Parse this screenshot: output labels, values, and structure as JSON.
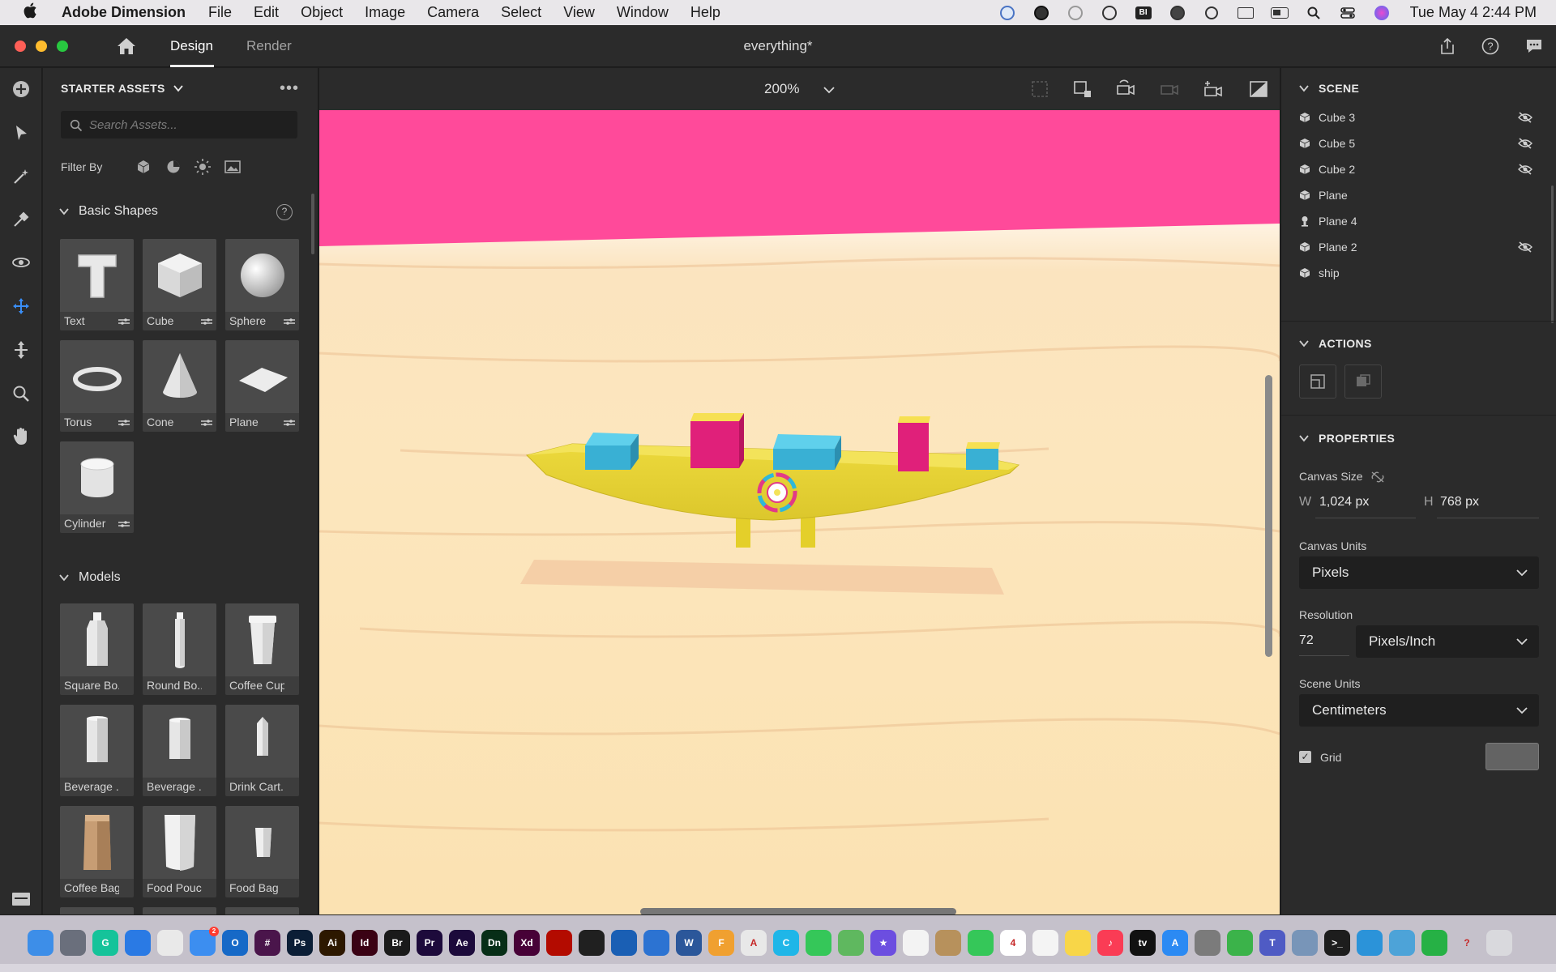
{
  "menubar": {
    "app_name": "Adobe Dimension",
    "items": [
      "File",
      "Edit",
      "Object",
      "Image",
      "Camera",
      "Select",
      "View",
      "Window",
      "Help"
    ],
    "clock": "Tue May 4  2:44 PM"
  },
  "titlebar": {
    "tab_design": "Design",
    "tab_render": "Render",
    "document_title": "everything*"
  },
  "assets": {
    "header": "STARTER ASSETS",
    "search_placeholder": "Search Assets...",
    "filter_label": "Filter By",
    "basic_shapes_title": "Basic Shapes",
    "basic_shapes": [
      {
        "label": "Text",
        "icon": "text-shape-icon"
      },
      {
        "label": "Cube",
        "icon": "cube-shape-icon"
      },
      {
        "label": "Sphere",
        "icon": "sphere-shape-icon"
      },
      {
        "label": "Torus",
        "icon": "torus-shape-icon"
      },
      {
        "label": "Cone",
        "icon": "cone-shape-icon"
      },
      {
        "label": "Plane",
        "icon": "plane-shape-icon"
      },
      {
        "label": "Cylinder",
        "icon": "cylinder-shape-icon"
      }
    ],
    "models_title": "Models",
    "models": [
      {
        "label": "Square Bo...",
        "icon": "square-bottle-icon"
      },
      {
        "label": "Round Bo...",
        "icon": "round-bottle-icon"
      },
      {
        "label": "Coffee Cup",
        "icon": "coffee-cup-icon"
      },
      {
        "label": "Beverage ...",
        "icon": "beverage-can-icon"
      },
      {
        "label": "Beverage ...",
        "icon": "beverage-can-icon"
      },
      {
        "label": "Drink Cart...",
        "icon": "drink-carton-icon"
      },
      {
        "label": "Coffee Bag",
        "icon": "coffee-bag-icon"
      },
      {
        "label": "Food Pouch",
        "icon": "food-pouch-icon"
      },
      {
        "label": "Food Bag",
        "icon": "food-bag-icon"
      }
    ]
  },
  "viewport": {
    "zoom": "200%",
    "colors": {
      "background_wall": "#ff4a9a",
      "floor": "#f7e3bd",
      "ship_hull": "#e8d83a",
      "cube_cyan": "#3ab4d6",
      "cube_magenta": "#e0207a"
    }
  },
  "scene": {
    "title": "SCENE",
    "items": [
      {
        "name": "Cube 3",
        "hidden": true
      },
      {
        "name": "Cube 5",
        "hidden": true
      },
      {
        "name": "Cube 2",
        "hidden": true
      },
      {
        "name": "Plane",
        "hidden": false
      },
      {
        "name": "Plane 4",
        "hidden": false
      },
      {
        "name": "Plane 2",
        "hidden": true
      },
      {
        "name": "ship",
        "hidden": false
      }
    ]
  },
  "actions": {
    "title": "ACTIONS"
  },
  "properties": {
    "title": "PROPERTIES",
    "canvas_size_label": "Canvas Size",
    "width_label": "W",
    "width_value": "1,024 px",
    "height_label": "H",
    "height_value": "768 px",
    "canvas_units_label": "Canvas Units",
    "canvas_units_value": "Pixels",
    "resolution_label": "Resolution",
    "resolution_value": "72",
    "resolution_unit": "Pixels/Inch",
    "scene_units_label": "Scene Units",
    "scene_units_value": "Centimeters",
    "grid_label": "Grid",
    "grid_checked": true
  },
  "dock": {
    "apps": [
      {
        "name": "Finder",
        "color": "#3d8ee8",
        "glyph": ""
      },
      {
        "name": "Launchpad",
        "color": "#6a6f7c",
        "glyph": ""
      },
      {
        "name": "Grammarly",
        "color": "#15c39a",
        "glyph": "G"
      },
      {
        "name": "Safari",
        "color": "#2a7ae4",
        "glyph": ""
      },
      {
        "name": "Chrome",
        "color": "#e9e9e9",
        "glyph": ""
      },
      {
        "name": "Mail",
        "color": "#3c8ef0",
        "glyph": "",
        "badge": "2"
      },
      {
        "name": "Outlook",
        "color": "#1669c7",
        "glyph": "O"
      },
      {
        "name": "Slack",
        "color": "#4a154b",
        "glyph": "#"
      },
      {
        "name": "Photoshop",
        "color": "#0b1e36",
        "glyph": "Ps"
      },
      {
        "name": "Illustrator",
        "color": "#2d1800",
        "glyph": "Ai"
      },
      {
        "name": "InDesign",
        "color": "#3a0214",
        "glyph": "Id"
      },
      {
        "name": "Bridge",
        "color": "#1a1a1a",
        "glyph": "Br"
      },
      {
        "name": "Premiere",
        "color": "#1d0a3b",
        "glyph": "Pr"
      },
      {
        "name": "After Effects",
        "color": "#1c0a3b",
        "glyph": "Ae"
      },
      {
        "name": "Dimension",
        "color": "#072e17",
        "glyph": "Dn"
      },
      {
        "name": "XD",
        "color": "#470137",
        "glyph": "Xd"
      },
      {
        "name": "Acrobat",
        "color": "#b30b00",
        "glyph": ""
      },
      {
        "name": "Terminal",
        "color": "#202020",
        "glyph": ""
      },
      {
        "name": "Hub",
        "color": "#1a5fb4",
        "glyph": ""
      },
      {
        "name": "Connect",
        "color": "#2c73d2",
        "glyph": ""
      },
      {
        "name": "Word",
        "color": "#2b579a",
        "glyph": "W"
      },
      {
        "name": "Fusion",
        "color": "#f0a030",
        "glyph": "F"
      },
      {
        "name": "Autocad",
        "color": "#e8e8e8",
        "glyph": "A"
      },
      {
        "name": "Canva",
        "color": "#1fb6e8",
        "glyph": "C"
      },
      {
        "name": "FaceTime",
        "color": "#35c759",
        "glyph": ""
      },
      {
        "name": "Maps",
        "color": "#5fb85f",
        "glyph": ""
      },
      {
        "name": "iMovie",
        "color": "#6c4ee0",
        "glyph": "★"
      },
      {
        "name": "Photos",
        "color": "#f3f3f3",
        "glyph": ""
      },
      {
        "name": "Contacts",
        "color": "#b7915c",
        "glyph": ""
      },
      {
        "name": "Messages",
        "color": "#35c759",
        "glyph": ""
      },
      {
        "name": "Calendar",
        "color": "#ffffff",
        "glyph": "4"
      },
      {
        "name": "Reminders",
        "color": "#f4f4f4",
        "glyph": ""
      },
      {
        "name": "Notes",
        "color": "#f8d648",
        "glyph": ""
      },
      {
        "name": "Music",
        "color": "#fa3c55",
        "glyph": "♪"
      },
      {
        "name": "TV",
        "color": "#111111",
        "glyph": "tv"
      },
      {
        "name": "App Store",
        "color": "#2b8af3",
        "glyph": "A"
      },
      {
        "name": "System Preferences",
        "color": "#7b7b7b",
        "glyph": ""
      },
      {
        "name": "Sphere",
        "color": "#3bb34a",
        "glyph": ""
      },
      {
        "name": "Teams",
        "color": "#4f5bc4",
        "glyph": "T"
      },
      {
        "name": "Preview",
        "color": "#7895b8",
        "glyph": ""
      },
      {
        "name": "Terminal2",
        "color": "#1d1d1d",
        "glyph": ">_"
      },
      {
        "name": "Quicktime",
        "color": "#2b93d9",
        "glyph": ""
      },
      {
        "name": "Monitor",
        "color": "#4da3d8",
        "glyph": ""
      },
      {
        "name": "Numbers",
        "color": "#26b145",
        "glyph": ""
      },
      {
        "name": "Help",
        "color": "#c5c1cb",
        "glyph": "?"
      },
      {
        "name": "Trash",
        "color": "#d9d9dd",
        "glyph": ""
      }
    ]
  }
}
